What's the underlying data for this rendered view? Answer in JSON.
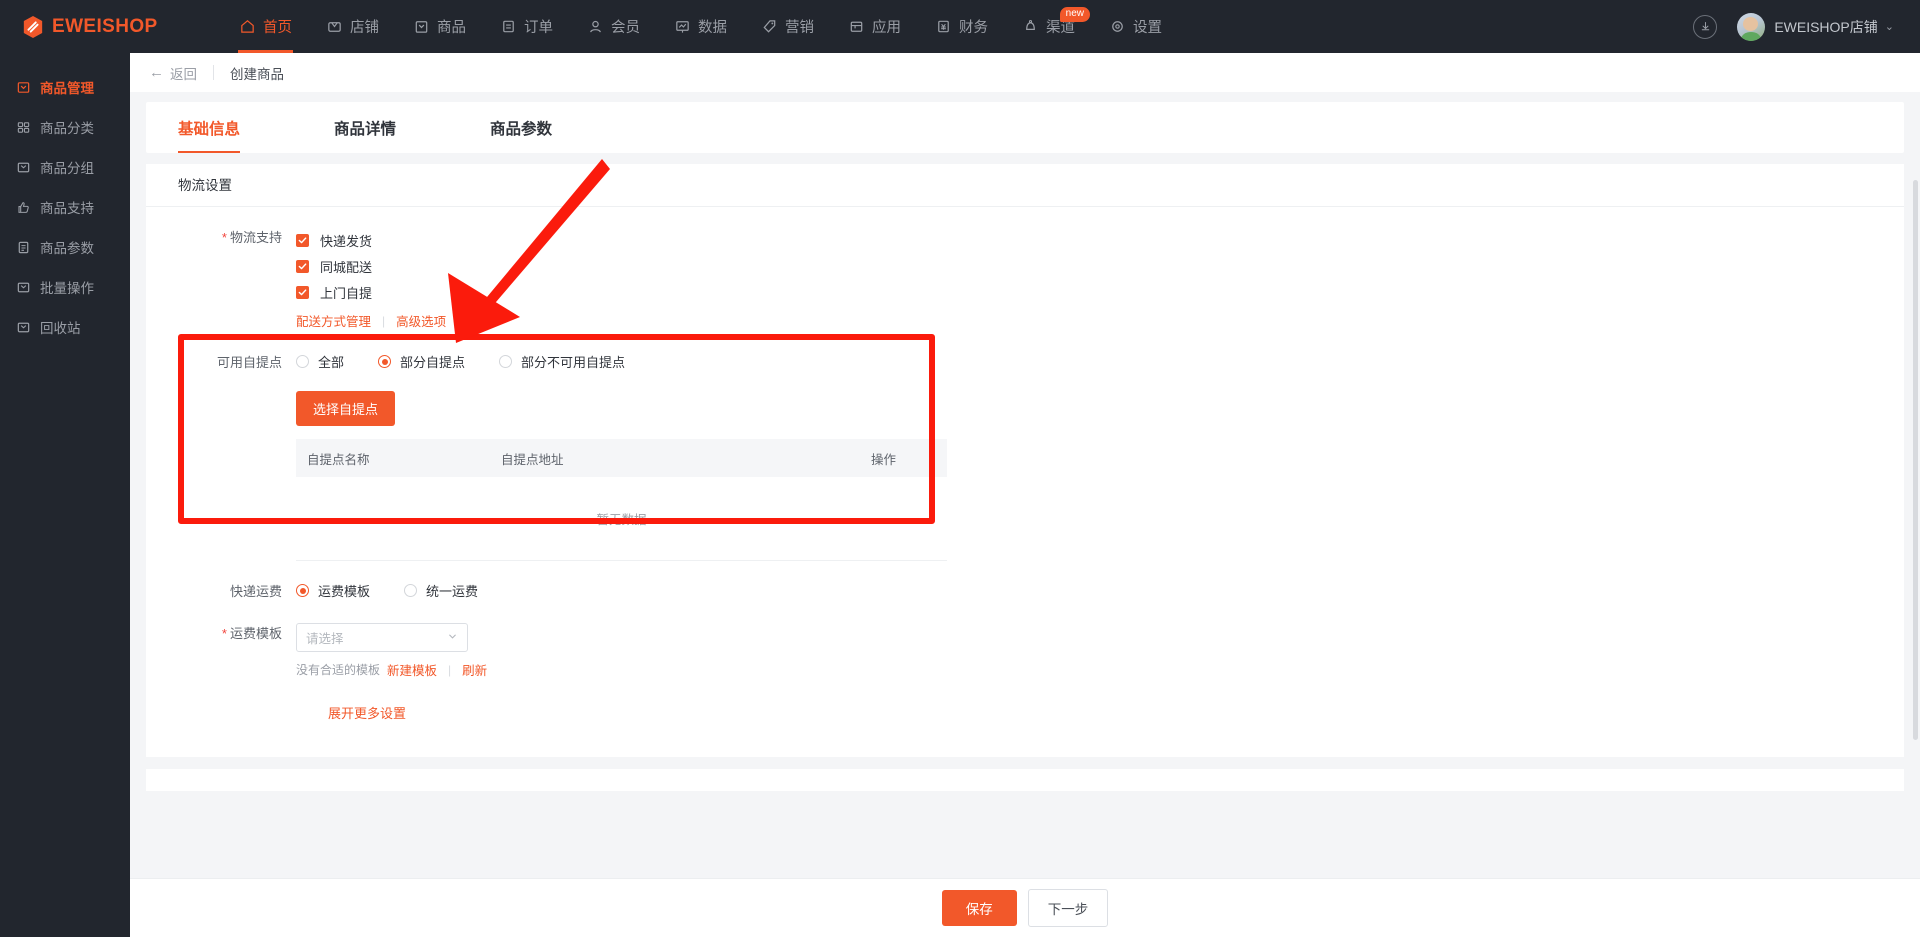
{
  "brand": {
    "name": "EWEISHOP",
    "color": "#f2582a"
  },
  "topnav": {
    "items": [
      {
        "label": "首页",
        "icon": "home-icon",
        "active": false
      },
      {
        "label": "店铺",
        "icon": "shop-icon",
        "active": false
      },
      {
        "label": "商品",
        "icon": "goods-icon",
        "active": true
      },
      {
        "label": "订单",
        "icon": "order-icon",
        "active": false
      },
      {
        "label": "会员",
        "icon": "member-icon",
        "active": false
      },
      {
        "label": "数据",
        "icon": "chart-icon",
        "active": false
      },
      {
        "label": "营销",
        "icon": "tag-icon",
        "active": false
      },
      {
        "label": "应用",
        "icon": "app-icon",
        "active": false
      },
      {
        "label": "财务",
        "icon": "finance-icon",
        "active": false
      },
      {
        "label": "渠道",
        "icon": "channel-icon",
        "active": false,
        "badge": "new"
      },
      {
        "label": "设置",
        "icon": "gear-icon",
        "active": false
      }
    ],
    "download_icon": "download-icon",
    "shop_name": "EWEISHOP店铺",
    "caret": "⌄"
  },
  "sidebar": {
    "items": [
      {
        "label": "商品管理",
        "icon": "goods-icon",
        "active": true
      },
      {
        "label": "商品分类",
        "icon": "category-icon",
        "active": false
      },
      {
        "label": "商品分组",
        "icon": "group-icon",
        "active": false
      },
      {
        "label": "商品支持",
        "icon": "thumbsup-icon",
        "active": false
      },
      {
        "label": "商品参数",
        "icon": "params-icon",
        "active": false
      },
      {
        "label": "批量操作",
        "icon": "batch-icon",
        "active": false
      },
      {
        "label": "回收站",
        "icon": "recycle-icon",
        "active": false
      }
    ]
  },
  "page_head": {
    "back_label": "返回",
    "back_arrow": "←",
    "title": "创建商品"
  },
  "tabs": [
    {
      "label": "基础信息",
      "active": true
    },
    {
      "label": "商品详情",
      "active": false
    },
    {
      "label": "商品参数",
      "active": false
    }
  ],
  "logistics": {
    "section_title": "物流设置",
    "support_label": "物流支持",
    "required_star": "*",
    "checkboxes": [
      {
        "label": "快递发货",
        "checked": true
      },
      {
        "label": "同城配送",
        "checked": true
      },
      {
        "label": "上门自提",
        "checked": true
      }
    ],
    "links": {
      "manage": "配送方式管理",
      "divider": "|",
      "advanced": "高级选项"
    },
    "pickup": {
      "label": "可用自提点",
      "options": [
        {
          "label": "全部",
          "selected": false
        },
        {
          "label": "部分自提点",
          "selected": true
        },
        {
          "label": "部分不可用自提点",
          "selected": false
        }
      ],
      "select_button": "选择自提点",
      "table": {
        "columns": [
          "自提点名称",
          "自提点地址",
          "操作"
        ],
        "empty_text": "暂无数据",
        "rows": []
      }
    },
    "freight": {
      "label": "快递运费",
      "options": [
        {
          "label": "运费模板",
          "selected": true
        },
        {
          "label": "统一运费",
          "selected": false
        }
      ],
      "template_label": "运费模板",
      "template_required": "*",
      "template_placeholder": "请选择",
      "template_value": "",
      "hint_text": "没有合适的模板",
      "hint_new": "新建模板",
      "hint_divider": "|",
      "hint_refresh": "刷新"
    },
    "expand_more": "展开更多设置"
  },
  "footer": {
    "save": "保存",
    "next": "下一步"
  }
}
